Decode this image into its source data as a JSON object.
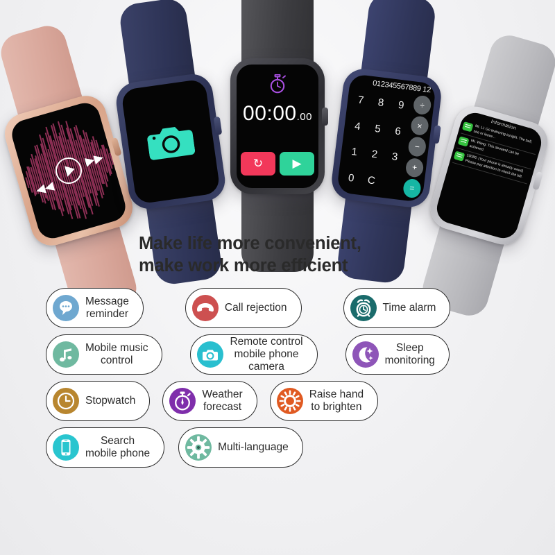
{
  "background_color": "#f3f3f5",
  "headline": {
    "line1": "Make life more convenient,",
    "line2": "make work more efficient",
    "color": "#2a2a2a"
  },
  "watches": [
    {
      "id": "music-watch",
      "case_color": "#d8a287",
      "band_color": "#d9a79b",
      "screen": {
        "app": "music-player",
        "waveform_color": "#8e2f55",
        "controls": [
          "previous",
          "play",
          "next"
        ]
      }
    },
    {
      "id": "camera-watch",
      "case_color": "#2b3052",
      "band_color": "#2e3457",
      "screen": {
        "app": "camera",
        "icon_color": "#35e0c0"
      }
    },
    {
      "id": "timer-watch",
      "case_color": "#2e2e33",
      "band_color": "#3c3c40",
      "screen": {
        "app": "stopwatch",
        "icon_color": "#a84fe0",
        "time_main": "00:00",
        "time_centiseconds": ".00",
        "reset_button": "↻",
        "reset_color": "#f2385a",
        "start_button": "▶",
        "start_color": "#2fd39a"
      }
    },
    {
      "id": "calculator-watch",
      "case_color": "#2c3155",
      "band_color": "#2f3559",
      "screen": {
        "app": "calculator",
        "display": "012345567889 12",
        "keys": [
          "7",
          "8",
          "9",
          "4",
          "5",
          "6",
          "1",
          "2",
          "3",
          "0",
          "C",
          ""
        ],
        "operators": [
          "÷",
          "×",
          "−",
          "+",
          "="
        ],
        "equals_color": "#16b6a4"
      }
    },
    {
      "id": "message-watch",
      "case_color": "#bcbcc1",
      "band_color": "#b9b9bd",
      "screen": {
        "app": "messages",
        "title": "Information",
        "bubble_color": "#35c23f",
        "messages": [
          "Mr. Li: Go teahering tonight. The ball, see or leave...",
          "Mr. Wang: This demand can be achieved.",
          "10086: (Your phone is already owed) Please pay attention to check the bill."
        ]
      }
    }
  ],
  "features": {
    "row1": [
      {
        "label": "Message\nreminder",
        "icon": "message-bubble-icon",
        "color": "#6fa8d0"
      },
      {
        "label": "Call rejection",
        "icon": "phone-hangup-icon",
        "color": "#cd5050"
      },
      {
        "label": "Time alarm",
        "icon": "alarm-clock-icon",
        "color": "#1a6b6b"
      }
    ],
    "row2": [
      {
        "label": "Mobile music\ncontrol",
        "icon": "music-note-icon",
        "color": "#6fb9a0"
      },
      {
        "label": "Remote control\nmobile phone\ncamera",
        "icon": "camera-icon",
        "color": "#29bfcf"
      },
      {
        "label": "Sleep\nmonitoring",
        "icon": "moon-stars-icon",
        "color": "#8e55b8"
      }
    ],
    "row3": [
      {
        "label": "Stopwatch",
        "icon": "clock-icon",
        "color": "#b8862f"
      },
      {
        "label": "Weather\nforecast",
        "icon": "stopwatch-icon",
        "color": "#7f2eab"
      },
      {
        "label": "Raise hand\nto brighten",
        "icon": "brightness-sun-icon",
        "color": "#e05a22"
      }
    ],
    "row4": [
      {
        "label": "Search\nmobile phone",
        "icon": "mobile-phone-icon",
        "color": "#29c5cf"
      },
      {
        "label": "Multi-language",
        "icon": "gear-icon",
        "color": "#6fb9a0"
      }
    ]
  }
}
